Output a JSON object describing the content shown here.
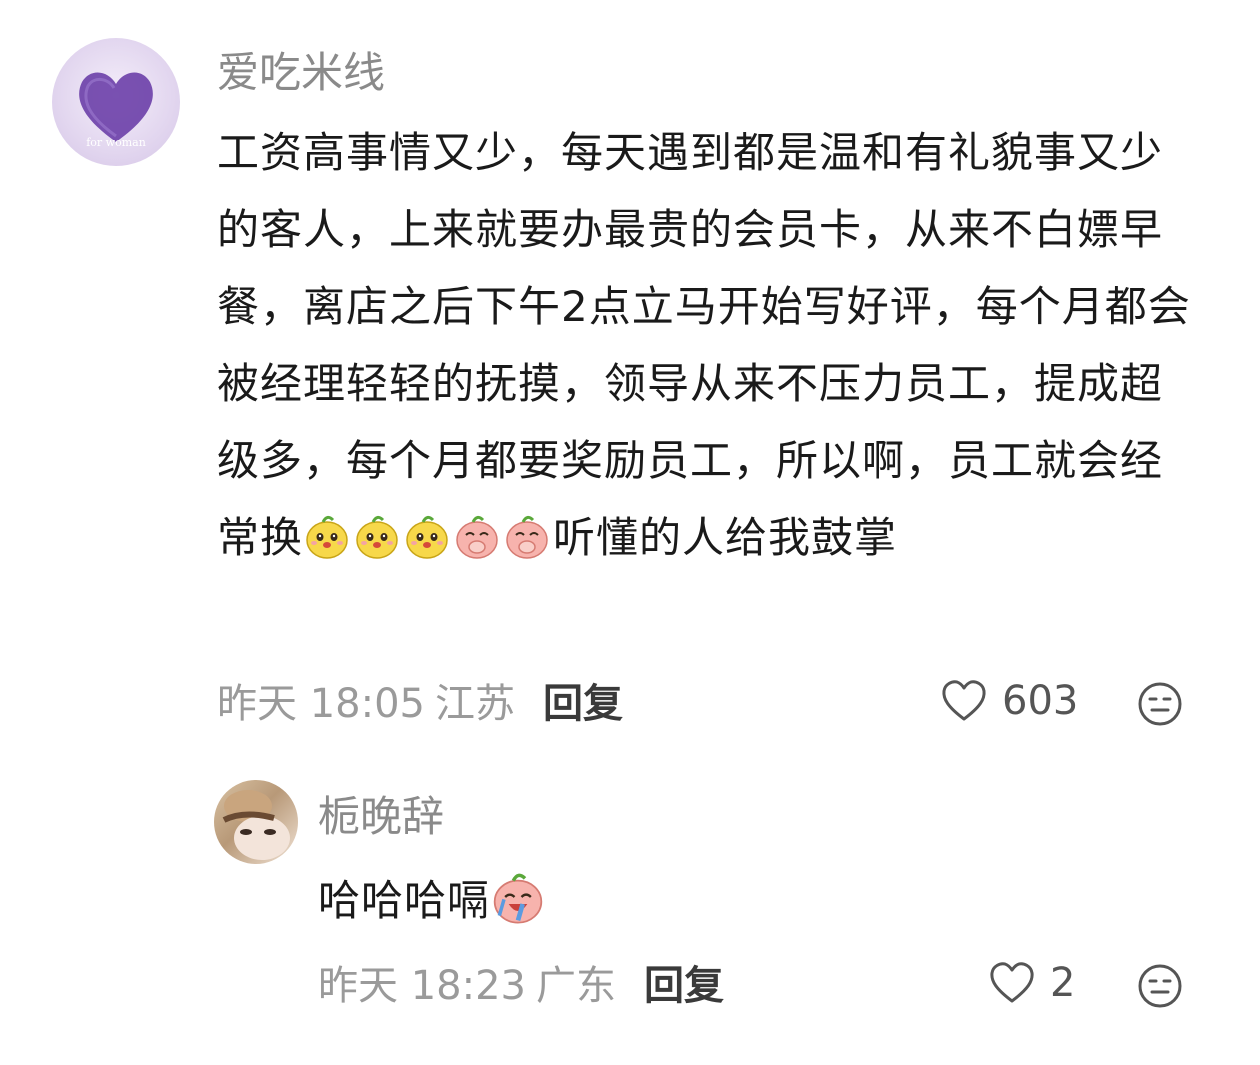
{
  "comments": [
    {
      "username": "爱吃米线",
      "avatar_caption": "for woman",
      "text_parts": [
        "工资高事情又少，每天遇到都是温和有礼貌事又少的客人，上来就要办最贵的会员卡，从来不白嫖早餐，离店之后下午2点立马开始写好评，每个月都会被经理轻轻的抚摸，领导从来不压力员工，提成超级多，每个月都要奖励员工，所以啊，员工就会经常换",
        "听懂的人给我鼓掌"
      ],
      "emojis": [
        "yellow-face-emoji",
        "yellow-face-emoji",
        "yellow-face-emoji",
        "pink-cover-mouth-emoji",
        "pink-cover-mouth-emoji"
      ],
      "time": "昨天 18:05",
      "region": "江苏",
      "reply_label": "回复",
      "likes": "603"
    },
    {
      "username": "栀晚辞",
      "text": "哈哈哈嗝",
      "emojis": [
        "pink-laugh-cry-emoji"
      ],
      "time": "昨天 18:23",
      "region": "广东",
      "reply_label": "回复",
      "likes": "2"
    }
  ],
  "icons": {
    "like": "heart-outline-icon",
    "reaction": "neutral-face-icon"
  },
  "colors": {
    "username": "#8a8a8a",
    "meta": "#9a9a9a",
    "text": "#1a1a1a",
    "avatar_heart": "#6b3fa8"
  }
}
